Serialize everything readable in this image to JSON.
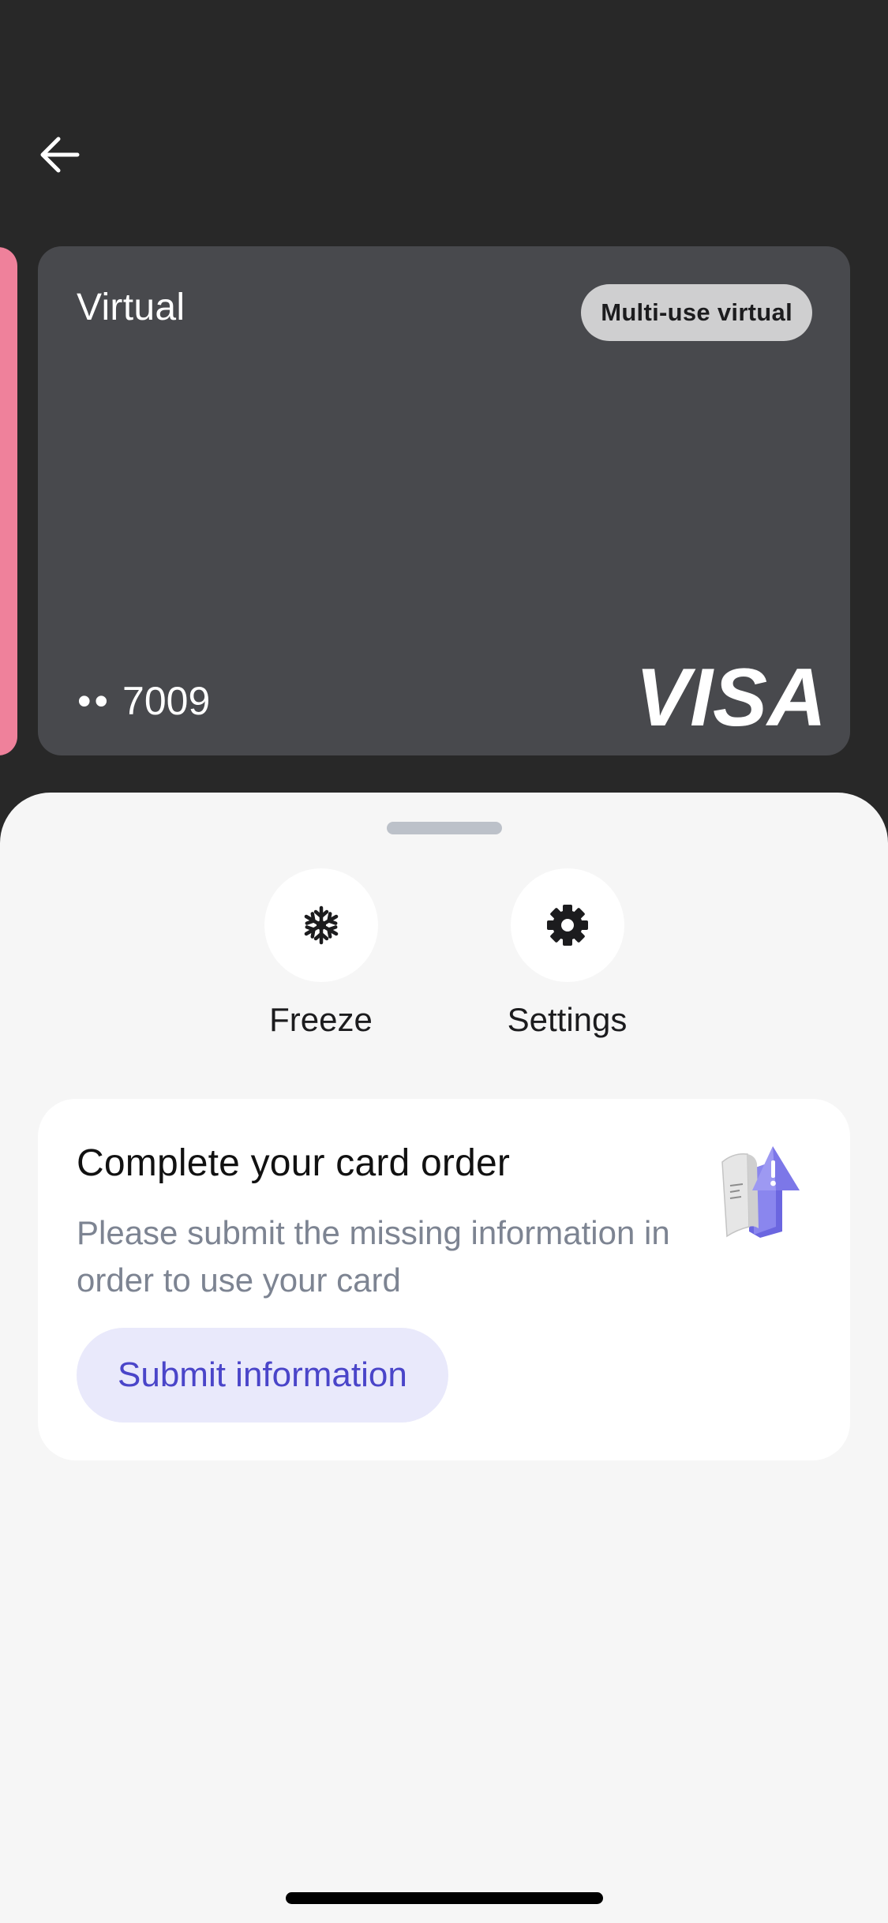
{
  "card": {
    "title": "Virtual",
    "badge": "Multi-use virtual",
    "dots": "••",
    "last4": "7009",
    "brand": "VISA",
    "color": "#48494d"
  },
  "actions": [
    {
      "label": "Freeze",
      "icon": "snowflake-icon"
    },
    {
      "label": "Settings",
      "icon": "gear-icon"
    }
  ],
  "order": {
    "title": "Complete your card order",
    "description": "Please submit the missing information in order to use your card",
    "button_label": "Submit information",
    "illustration": "document-warning-illustration"
  },
  "colors": {
    "background": "#282828",
    "sheet": "#f6f6f6",
    "accent": "#4a45c9",
    "accent_bg": "#e9e9fb",
    "peek_card": "#ef819b"
  }
}
